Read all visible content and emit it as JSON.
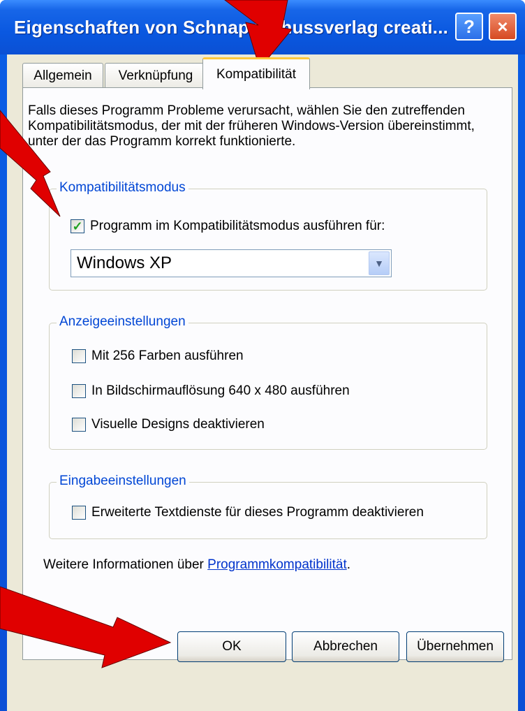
{
  "window": {
    "title": "Eigenschaften von Schnappschussverlag creati...",
    "help_label": "?",
    "close_label": "×"
  },
  "tabs": [
    {
      "label": "Allgemein",
      "selected": false
    },
    {
      "label": "Verknüpfung",
      "selected": false
    },
    {
      "label": "Kompatibilität",
      "selected": true
    }
  ],
  "description": "Falls dieses Programm Probleme verursacht, wählen Sie den zutreffenden Kompatibilitätsmodus, der mit der früheren Windows-Version übereinstimmt, unter der das Programm korrekt funktionierte.",
  "compat_group": {
    "legend": "Kompatibilitätsmodus",
    "checkbox_label": "Programm im Kompatibilitätsmodus ausführen für:",
    "checked": true,
    "combo_value": "Windows XP"
  },
  "display_group": {
    "legend": "Anzeigeeinstellungen",
    "options": [
      {
        "label": "Mit 256 Farben ausführen",
        "checked": false
      },
      {
        "label": "In Bildschirmauflösung 640 x 480 ausführen",
        "checked": false
      },
      {
        "label": "Visuelle Designs deaktivieren",
        "checked": false
      }
    ]
  },
  "input_group": {
    "legend": "Eingabeeinstellungen",
    "options": [
      {
        "label": "Erweiterte Textdienste für dieses Programm deaktivieren",
        "checked": false
      }
    ]
  },
  "more_info": {
    "prefix": "Weitere Informationen über ",
    "link": "Programmkompatibilität",
    "suffix": "."
  },
  "buttons": {
    "ok": "OK",
    "cancel": "Abbrechen",
    "apply": "Übernehmen"
  },
  "colors": {
    "accent_arrow": "#e00000",
    "legend_text": "#0046d5",
    "title_bar": "#0a58e0"
  }
}
